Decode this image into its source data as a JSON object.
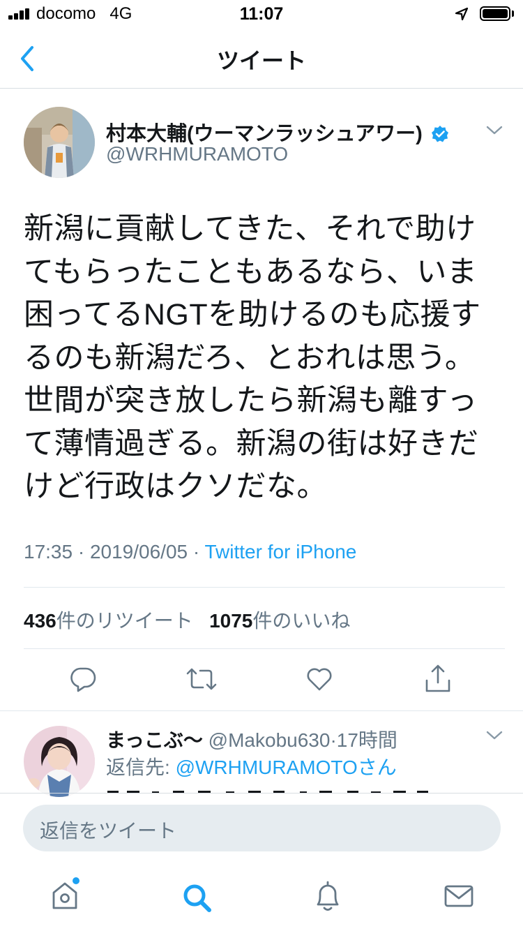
{
  "status_bar": {
    "carrier": "docomo",
    "network": "4G",
    "time": "11:07"
  },
  "nav": {
    "back_icon": "chevron-left-icon",
    "title": "ツイート"
  },
  "tweet": {
    "author_name": "村本大輔(ウーマンラッシュアワー)",
    "verified": true,
    "handle": "@WRHMURAMOTO",
    "text_lines": [
      "新潟に貢献してきた、それで助け",
      "てもらったこともあるなら、いま",
      "困ってるNGTを助けるのも応援す",
      "るのも新潟だろ、とおれは思う。",
      "世間が突き放したら新潟も離すっ",
      "て薄情過ぎる。新潟の街は好きだ",
      "けど行政はクソだな。"
    ],
    "time": "17:35",
    "date": "2019/06/05",
    "source": "Twitter for iPhone",
    "retweet_count": "436",
    "retweet_label": "件のリツイート",
    "like_count": "1075",
    "like_label": "件のいいね"
  },
  "actions": [
    "reply-icon",
    "retweet-icon",
    "like-icon",
    "share-icon"
  ],
  "reply": {
    "name": "まっこぶ〜",
    "handle": "@Makobu630",
    "time": "17時間",
    "reply_to_label": "返信先: ",
    "reply_to_handle": "@WRHMURAMOTOさん"
  },
  "composer": {
    "placeholder": "返信をツイート"
  },
  "tab_bar": [
    "home-icon",
    "search-icon",
    "notifications-icon",
    "messages-icon"
  ],
  "colors": {
    "accent": "#1da1f2",
    "secondary_text": "#657786",
    "primary_text": "#14171a"
  }
}
